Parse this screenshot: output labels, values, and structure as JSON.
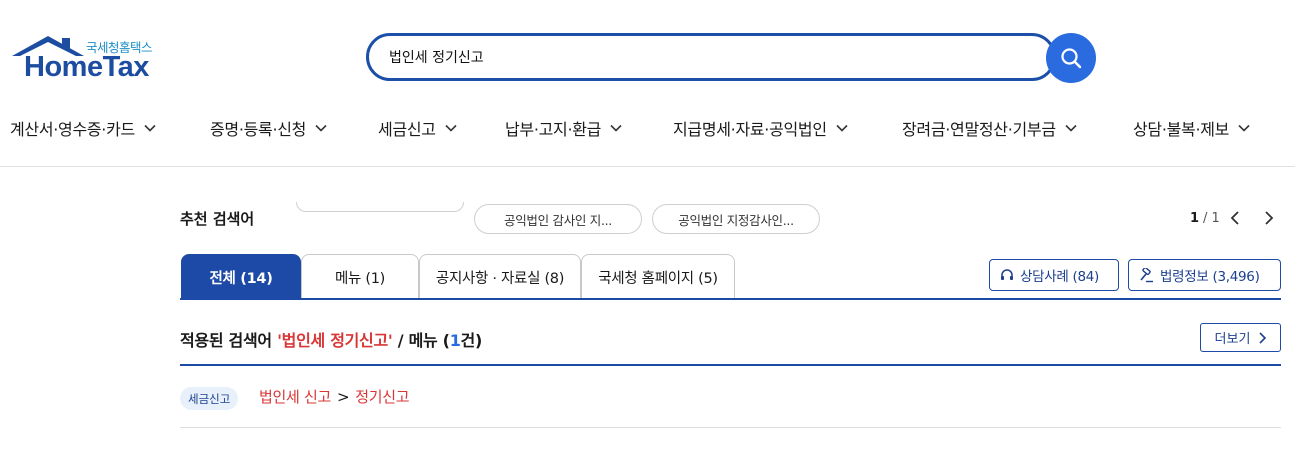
{
  "logo": {
    "sub_text": "국세청홈택스",
    "main_text": "HomeTax"
  },
  "search": {
    "value": "법인세 정기신고",
    "icon": "search-icon"
  },
  "gnb": {
    "items": [
      {
        "label": "계산서·영수증·카드"
      },
      {
        "label": "증명·등록·신청"
      },
      {
        "label": "세금신고"
      },
      {
        "label": "납부·고지·환급"
      },
      {
        "label": "지급명세·자료·공익법인"
      },
      {
        "label": "장려금·연말정산·기부금"
      },
      {
        "label": "상담·불복·제보"
      }
    ]
  },
  "recommended": {
    "title": "추천 검색어",
    "items": [
      {
        "label": "공익법인 감사인 지..."
      },
      {
        "label": "공익법인 지정감사인..."
      }
    ],
    "pager": {
      "current": "1",
      "total": "/ 1"
    }
  },
  "tabs": [
    {
      "label": "전체 (14)"
    },
    {
      "label": "메뉴 (1)"
    },
    {
      "label": "공지사항 · 자료실 (8)"
    },
    {
      "label": "국세청 홈페이지 (5)"
    }
  ],
  "side_buttons": {
    "consult": "상담사례 (84)",
    "law": "법령정보 (3,496)"
  },
  "result": {
    "prefix": "적용된 검색어 ",
    "keyword": "'법인세 정기신고'",
    "middle": " / 메뉴 (",
    "count": "1",
    "suffix": "건)",
    "more_label": "더보기"
  },
  "result_item": {
    "badge": "세금신고",
    "crumb1": "법인세 신고",
    "sep": ">",
    "crumb2": "정기신고"
  },
  "colors": {
    "brand_blue": "#1c4aa6",
    "search_button": "#2a6ce0",
    "keyword_red": "#d93636",
    "badge_bg": "#e8f1fb"
  }
}
